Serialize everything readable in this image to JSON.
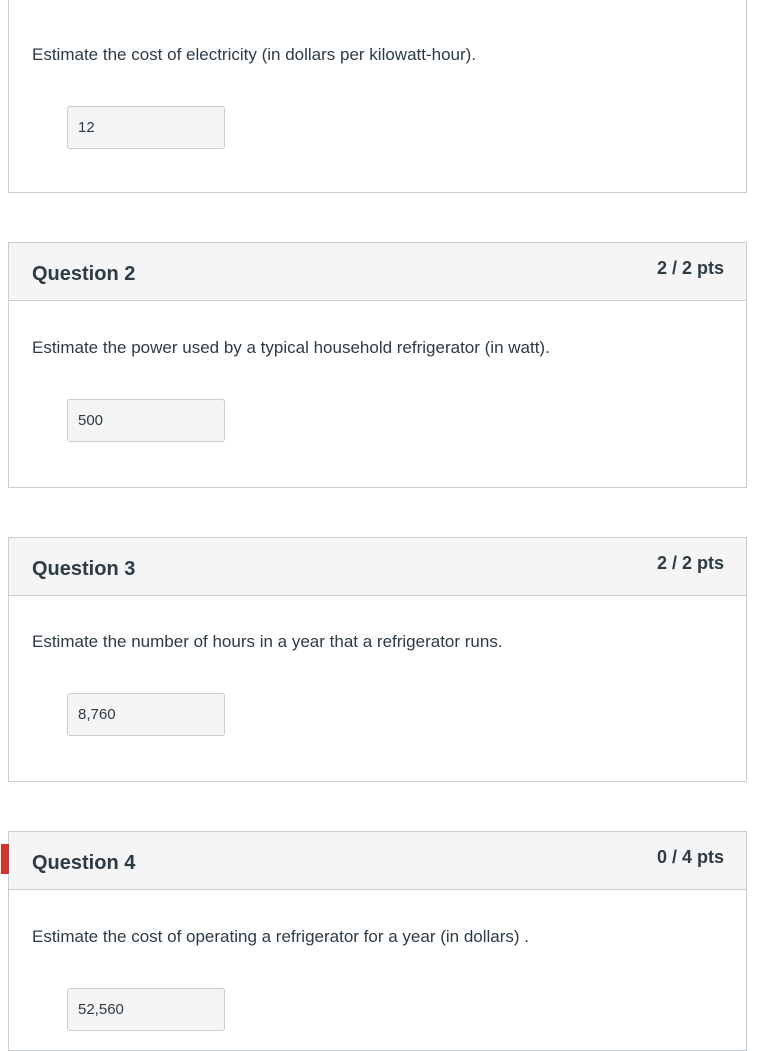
{
  "questions": [
    {
      "title": "",
      "points": "",
      "text": "Estimate the cost of electricity (in dollars per kilowatt-hour).",
      "answer": "12"
    },
    {
      "title": "Question 2",
      "points": "2 / 2 pts",
      "text": "Estimate the power used by a typical household refrigerator (in watt).",
      "answer": "500"
    },
    {
      "title": "Question 3",
      "points": "2 / 2 pts",
      "text": "Estimate the number of hours in a year that a refrigerator runs.",
      "answer": "8,760"
    },
    {
      "title": "Question 4",
      "points": "0 / 4 pts",
      "text": "Estimate the cost of operating a refrigerator for a year (in dollars) .",
      "answer": "52,560",
      "incorrect_flag_color": "#d0342c"
    }
  ]
}
